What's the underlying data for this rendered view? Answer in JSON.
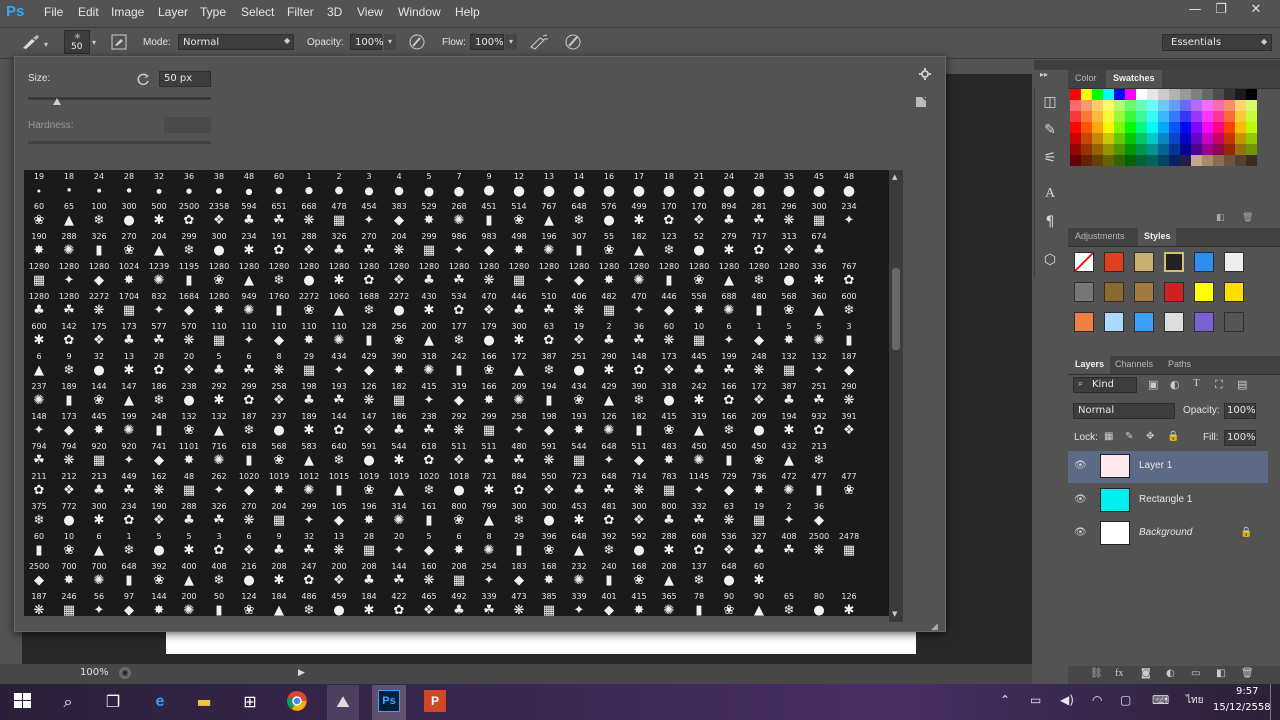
{
  "app": {
    "logo": "Ps"
  },
  "menu": [
    "File",
    "Edit",
    "Image",
    "Layer",
    "Type",
    "Select",
    "Filter",
    "3D",
    "View",
    "Window",
    "Help"
  ],
  "window_controls": {
    "minimize": "—",
    "restore": "❐",
    "close": "✕"
  },
  "options_bar": {
    "brush_size": "50",
    "mode_label": "Mode:",
    "mode_value": "Normal",
    "opacity_label": "Opacity:",
    "opacity_value": "100%",
    "flow_label": "Flow:",
    "flow_value": "100%",
    "workspace": "Essentials"
  },
  "brush_popup": {
    "size_label": "Size:",
    "size_value": "50 px",
    "hardness_label": "Hardness:",
    "size_slider": 0.16
  },
  "brush_sizes": [
    [
      "19",
      "18",
      "24",
      "28",
      "32",
      "36",
      "38",
      "48",
      "60",
      "1",
      "2",
      "3",
      "4",
      "5",
      "7",
      "9",
      "12",
      "13",
      "14",
      "16",
      "17",
      "18",
      "21",
      "24",
      "28",
      "35",
      "45",
      "48"
    ],
    [
      "60",
      "65",
      "100",
      "300",
      "500",
      "2500",
      "2358",
      "594",
      "651",
      "668",
      "478",
      "454",
      "383",
      "529",
      "268",
      "451",
      "514",
      "767",
      "648",
      "576",
      "499",
      "170",
      "170",
      "894",
      "281",
      "296",
      "300",
      "234"
    ],
    [
      "190",
      "288",
      "326",
      "270",
      "204",
      "299",
      "300",
      "234",
      "191",
      "288",
      "326",
      "270",
      "204",
      "299",
      "986",
      "983",
      "498",
      "196",
      "307",
      "55",
      "182",
      "123",
      "52",
      "279",
      "717",
      "313",
      "674",
      ""
    ],
    [
      "1280",
      "1280",
      "1280",
      "1024",
      "1239",
      "1195",
      "1280",
      "1280",
      "1280",
      "1280",
      "1280",
      "1280",
      "1280",
      "1280",
      "1280",
      "1280",
      "1280",
      "1280",
      "1280",
      "1280",
      "1280",
      "1280",
      "1280",
      "1280",
      "1280",
      "1280",
      "336",
      "767"
    ],
    [
      "1280",
      "1280",
      "2272",
      "1704",
      "832",
      "1684",
      "1280",
      "949",
      "1760",
      "2272",
      "1060",
      "1688",
      "2272",
      "430",
      "534",
      "470",
      "446",
      "510",
      "406",
      "482",
      "470",
      "446",
      "558",
      "688",
      "480",
      "568",
      "360",
      "600"
    ],
    [
      "600",
      "142",
      "175",
      "173",
      "577",
      "570",
      "110",
      "110",
      "110",
      "110",
      "110",
      "128",
      "256",
      "200",
      "177",
      "179",
      "300",
      "63",
      "19",
      "2",
      "36",
      "60",
      "10",
      "6",
      "1",
      "5",
      "5",
      "3"
    ],
    [
      "6",
      "9",
      "32",
      "13",
      "28",
      "20",
      "5",
      "6",
      "8",
      "29",
      "434",
      "429",
      "390",
      "318",
      "242",
      "166",
      "172",
      "387",
      "251",
      "290",
      "148",
      "173",
      "445",
      "199",
      "248",
      "132",
      "132",
      "187"
    ],
    [
      "237",
      "189",
      "144",
      "147",
      "186",
      "238",
      "292",
      "299",
      "258",
      "198",
      "193",
      "126",
      "182",
      "415",
      "319",
      "166",
      "209",
      "194",
      "434",
      "429",
      "390",
      "318",
      "242",
      "166",
      "172",
      "387",
      "251",
      "290"
    ],
    [
      "148",
      "173",
      "445",
      "199",
      "248",
      "132",
      "132",
      "187",
      "237",
      "189",
      "144",
      "147",
      "186",
      "238",
      "292",
      "299",
      "258",
      "198",
      "193",
      "126",
      "182",
      "415",
      "319",
      "166",
      "209",
      "194",
      "932",
      "391"
    ],
    [
      "794",
      "794",
      "920",
      "920",
      "741",
      "1101",
      "716",
      "618",
      "568",
      "583",
      "640",
      "591",
      "544",
      "618",
      "511",
      "511",
      "480",
      "591",
      "544",
      "648",
      "511",
      "483",
      "450",
      "450",
      "450",
      "432",
      "213",
      ""
    ],
    [
      "211",
      "212",
      "213",
      "449",
      "162",
      "48",
      "262",
      "1020",
      "1019",
      "1012",
      "1015",
      "1019",
      "1019",
      "1020",
      "1018",
      "721",
      "884",
      "550",
      "723",
      "648",
      "714",
      "783",
      "1145",
      "729",
      "736",
      "472",
      "477",
      "477"
    ],
    [
      "375",
      "772",
      "300",
      "234",
      "190",
      "288",
      "326",
      "270",
      "204",
      "299",
      "105",
      "196",
      "314",
      "161",
      "800",
      "799",
      "300",
      "300",
      "453",
      "481",
      "300",
      "800",
      "332",
      "63",
      "19",
      "2",
      "36",
      ""
    ],
    [
      "60",
      "10",
      "6",
      "1",
      "5",
      "5",
      "3",
      "6",
      "9",
      "32",
      "13",
      "28",
      "20",
      "5",
      "6",
      "8",
      "29",
      "396",
      "648",
      "392",
      "592",
      "288",
      "608",
      "536",
      "327",
      "408",
      "2500",
      "2478"
    ],
    [
      "2500",
      "700",
      "700",
      "648",
      "392",
      "400",
      "408",
      "216",
      "208",
      "247",
      "200",
      "208",
      "144",
      "160",
      "208",
      "254",
      "183",
      "168",
      "232",
      "240",
      "168",
      "208",
      "137",
      "648",
      "60",
      "",
      "",
      ""
    ],
    [
      "187",
      "246",
      "56",
      "97",
      "144",
      "200",
      "50",
      "124",
      "184",
      "486",
      "459",
      "184",
      "422",
      "465",
      "492",
      "339",
      "473",
      "385",
      "339",
      "401",
      "415",
      "365",
      "78",
      "90",
      "90",
      "65",
      "80",
      "126"
    ]
  ],
  "panels": {
    "color_tabs": [
      "Color",
      "Swatches"
    ],
    "style_tabs": [
      "Adjustments",
      "Styles"
    ],
    "layer_tabs": [
      "Layers",
      "Channels",
      "Paths"
    ],
    "kind_label": "Kind",
    "blend_mode": "Normal",
    "opacity_label": "Opacity:",
    "opacity_value": "100%",
    "lock_label": "Lock:",
    "fill_label": "Fill:",
    "fill_value": "100%",
    "layers": [
      {
        "name": "Layer 1",
        "selected": true,
        "thumb": "#ffe9ee"
      },
      {
        "name": "Rectangle 1",
        "selected": false,
        "thumb": "#00f0f0"
      },
      {
        "name": "Background",
        "selected": false,
        "thumb": "#ffffff"
      }
    ]
  },
  "status": {
    "zoom": "100%"
  },
  "taskbar": {
    "time": "9:57",
    "date": "15/12/2558",
    "lang": "ไทย"
  }
}
